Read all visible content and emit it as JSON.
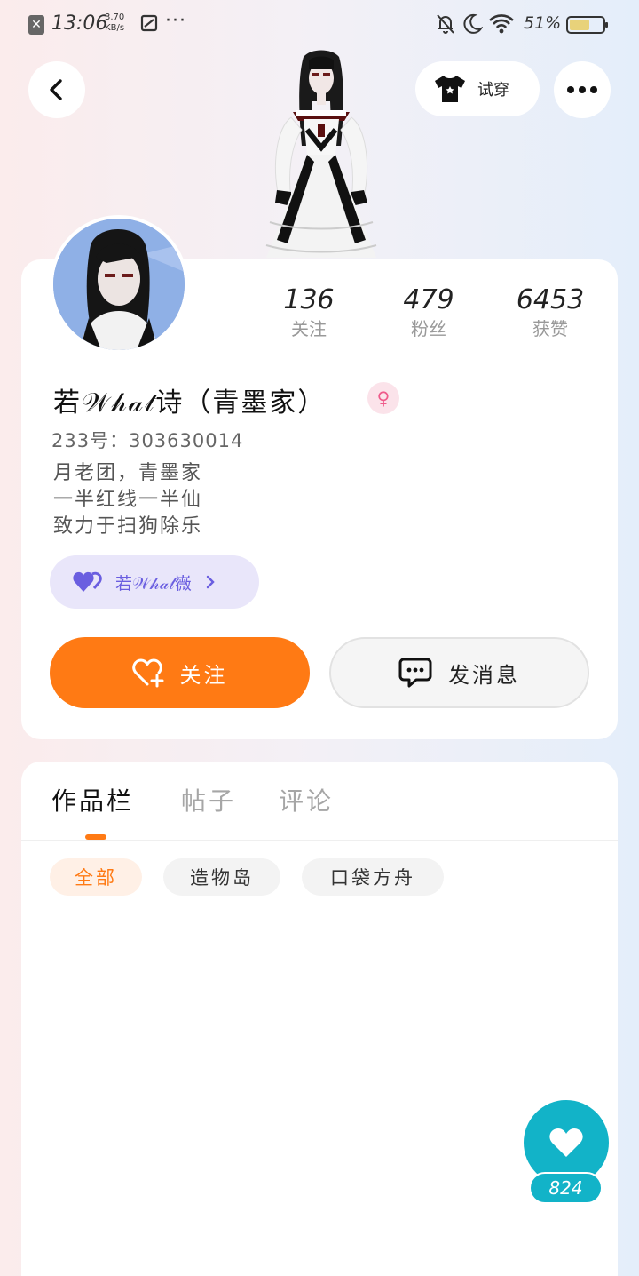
{
  "status_bar": {
    "time": "13:06",
    "net_speed_value": "3.70",
    "net_speed_unit": "KB/s",
    "more": "···",
    "battery": "51%"
  },
  "header": {
    "tryon_label": "试穿"
  },
  "profile": {
    "stats": [
      {
        "value": "136",
        "label": "关注"
      },
      {
        "value": "479",
        "label": "粉丝"
      },
      {
        "value": "6453",
        "label": "获赞"
      }
    ],
    "name": "若𝒲𝒽𝒶𝓉诗（青墨家）",
    "gender_symbol": "♀",
    "uid": "233号：303630014",
    "bio": [
      "月老团，青墨家",
      "一半红线一半仙",
      "致力于扫狗除乐"
    ],
    "fanclub_label": "若𝒲𝒽𝒶𝓉嶶",
    "follow_label": "关注",
    "message_label": "发消息"
  },
  "tabs": [
    {
      "label": "作品栏",
      "active": true
    },
    {
      "label": "帖子",
      "active": false
    },
    {
      "label": "评论",
      "active": false
    }
  ],
  "filters": [
    {
      "label": "全部",
      "active": true
    },
    {
      "label": "造物岛",
      "active": false
    },
    {
      "label": "口袋方舟",
      "active": false
    }
  ],
  "like": {
    "count": "824"
  },
  "colors": {
    "accent": "#ff7a14",
    "like": "#12b3c8",
    "fanclub": "#6a5ee0"
  }
}
